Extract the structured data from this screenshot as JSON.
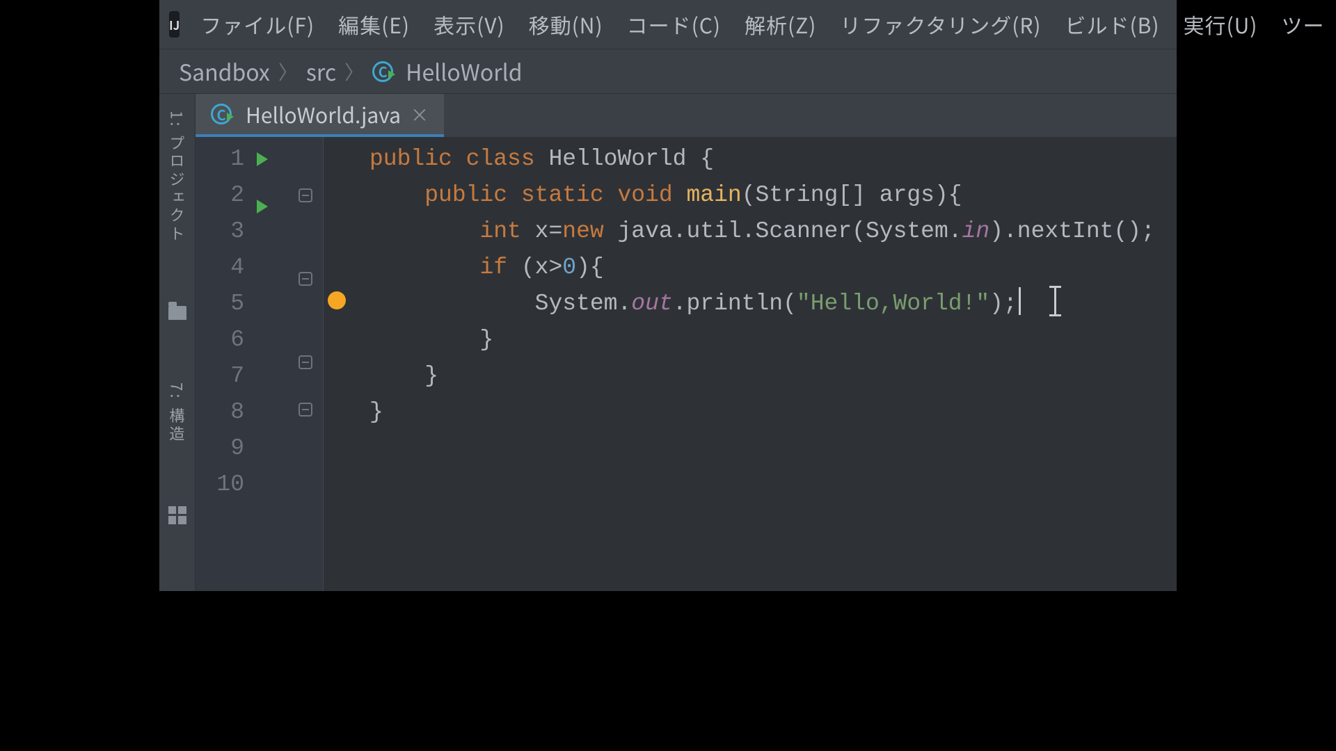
{
  "menu": {
    "items": [
      "ファイル(F)",
      "編集(E)",
      "表示(V)",
      "移動(N)",
      "コード(C)",
      "解析(Z)",
      "リファクタリング(R)",
      "ビルド(B)",
      "実行(U)",
      "ツー"
    ]
  },
  "app_badge": "IJ",
  "breadcrumb": {
    "root": "Sandbox",
    "mid": "src",
    "leaf": "HelloWorld"
  },
  "left_well": {
    "project_label": "1: プロジェクト",
    "structure_label": "7: 構造"
  },
  "tab": {
    "label": "HelloWorld.java"
  },
  "code": {
    "lines": [
      {
        "n": "1",
        "run": true,
        "fold": false,
        "html": "<span class='kw'>public class</span> HelloWorld {"
      },
      {
        "n": "2",
        "run": true,
        "fold": true,
        "html": "    <span class='kw'>public static void</span> <span class='fn'>main</span>(String[] args){"
      },
      {
        "n": "3",
        "run": false,
        "fold": false,
        "html": "        <span class='kw'>int</span> x=<span class='kw'>new</span> java.util.Scanner(System.<span class='field'>in</span>).nextInt();"
      },
      {
        "n": "4",
        "run": false,
        "fold": true,
        "html": "        <span class='kw'>if</span> (x&gt;<span class='num'>0</span>){"
      },
      {
        "n": "5",
        "run": false,
        "fold": false,
        "bulb": true,
        "html": "            System.<span class='field'>out</span>.println(<span class='str'>\"Hello,World!\"</span>);<span class='caret'></span><span class='text-cursor'></span>"
      },
      {
        "n": "6",
        "run": false,
        "fold": true,
        "html": "        }"
      },
      {
        "n": "7",
        "run": false,
        "fold": true,
        "html": "    }"
      },
      {
        "n": "8",
        "run": false,
        "fold": false,
        "html": "}"
      },
      {
        "n": "9",
        "run": false,
        "fold": false,
        "html": ""
      },
      {
        "n": "10",
        "run": false,
        "fold": false,
        "html": ""
      }
    ]
  }
}
